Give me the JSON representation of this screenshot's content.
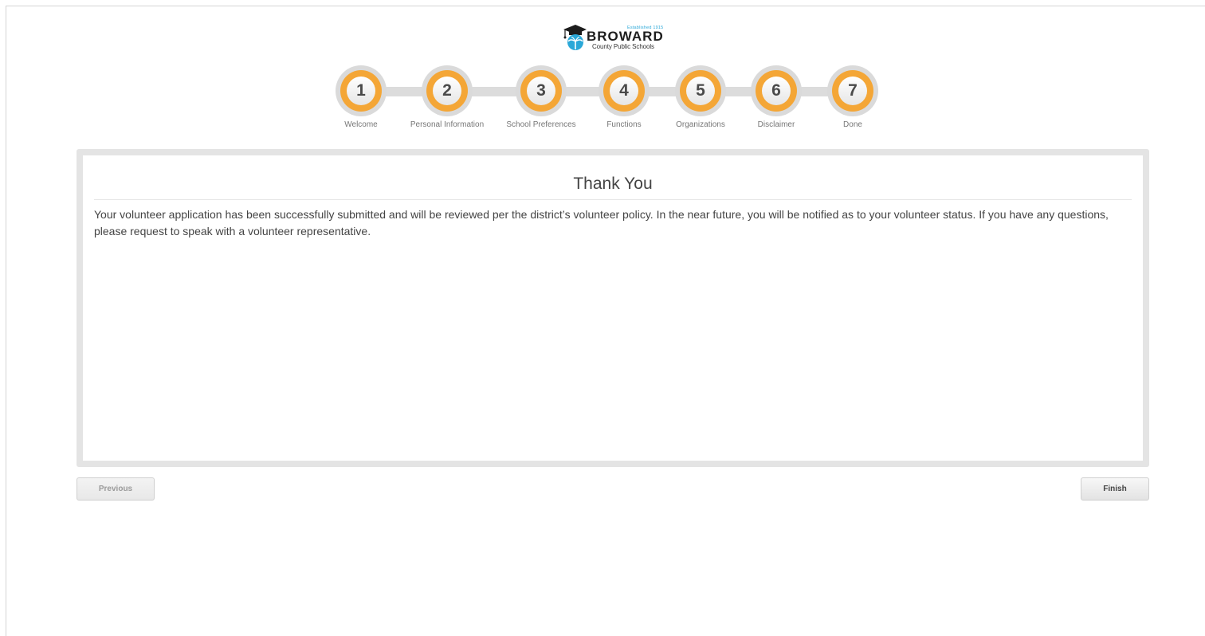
{
  "logo": {
    "established": "Established 1915",
    "name": "BROWARD",
    "subtitle": "County Public Schools"
  },
  "colors": {
    "step_ring": "#f4a636",
    "step_outer": "#dadada",
    "panel_border": "#e4e4e4",
    "text": "#444444",
    "logo_accent": "#2aa8d8"
  },
  "steps": [
    {
      "number": "1",
      "label": "Welcome"
    },
    {
      "number": "2",
      "label": "Personal Information"
    },
    {
      "number": "3",
      "label": "School Preferences"
    },
    {
      "number": "4",
      "label": "Functions"
    },
    {
      "number": "5",
      "label": "Organizations"
    },
    {
      "number": "6",
      "label": "Disclaimer"
    },
    {
      "number": "7",
      "label": "Done"
    }
  ],
  "panel": {
    "title": "Thank You",
    "message": "Your volunteer application has been successfully submitted and will be reviewed per the district’s volunteer policy. In the near future, you will be notified as to your volunteer status. If you have any questions, please request to speak with a volunteer representative."
  },
  "buttons": {
    "previous_label": "Previous",
    "finish_label": "Finish"
  }
}
